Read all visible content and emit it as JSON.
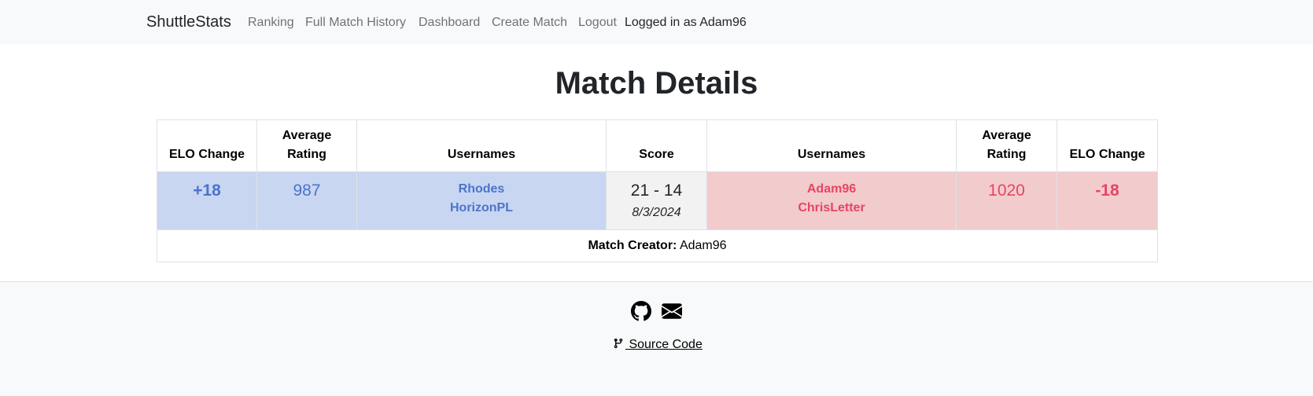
{
  "navbar": {
    "brand": "ShuttleStats",
    "links": [
      "Ranking",
      "Full Match History",
      "Dashboard",
      "Create Match",
      "Logout"
    ],
    "logged_in_text": "Logged in as Adam96"
  },
  "page": {
    "title": "Match Details"
  },
  "table": {
    "headers": [
      "ELO Change",
      "Average Rating",
      "Usernames",
      "Score",
      "Usernames",
      "Average Rating",
      "ELO Change"
    ],
    "team1": {
      "elo_change": "+18",
      "average_rating": "987",
      "usernames": [
        "Rhodes",
        "HorizonPL"
      ]
    },
    "score": {
      "value": "21 - 14",
      "date": "8/3/2024"
    },
    "team2": {
      "elo_change": "-18",
      "average_rating": "1020",
      "usernames": [
        "Adam96",
        "ChrisLetter"
      ]
    },
    "creator_label": "Match Creator:",
    "creator_name": "Adam96"
  },
  "footer": {
    "github_icon": "github-icon",
    "email_icon": "envelope-icon",
    "source_link": " Source Code",
    "source_icon": "git-branch-icon"
  },
  "colors": {
    "team1_bg": "#c9d6f1",
    "team1_text": "#4a74cc",
    "team2_bg": "#f2cbcd",
    "team2_text": "#e64563",
    "score_bg": "#f2f2f2",
    "navbar_bg": "#f8f9fa"
  }
}
